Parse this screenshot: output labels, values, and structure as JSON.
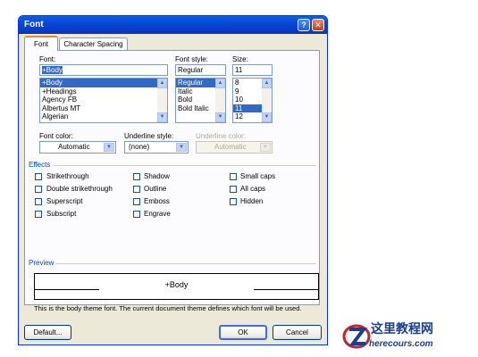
{
  "window": {
    "title": "Font",
    "help": "?",
    "close": "✕"
  },
  "tabs": [
    {
      "label": "Font"
    },
    {
      "label": "Character Spacing"
    }
  ],
  "font": {
    "label": "Font:",
    "value": "+Body",
    "items": [
      "+Body",
      "+Headings",
      "Agency FB",
      "Albertus MT",
      "Algerian"
    ],
    "selected": "+Body"
  },
  "style": {
    "label": "Font style:",
    "value": "Regular",
    "items": [
      "Regular",
      "Italic",
      "Bold",
      "Bold Italic"
    ],
    "selected": "Regular"
  },
  "size": {
    "label": "Size:",
    "value": "11",
    "items": [
      "8",
      "9",
      "10",
      "11",
      "12"
    ],
    "selected": "11"
  },
  "font_color": {
    "label": "Font color:",
    "value": "Automatic"
  },
  "underline_style": {
    "label": "Underline style:",
    "value": "(none)"
  },
  "underline_color": {
    "label": "Underline color:",
    "value": "Automatic"
  },
  "effects": {
    "label": "Effects",
    "items": [
      {
        "label": "Strikethrough",
        "checked": false
      },
      {
        "label": "Double strikethrough",
        "checked": false
      },
      {
        "label": "Superscript",
        "checked": false
      },
      {
        "label": "Subscript",
        "checked": false
      },
      {
        "label": "Shadow",
        "checked": false
      },
      {
        "label": "Outline",
        "checked": false
      },
      {
        "label": "Emboss",
        "checked": false
      },
      {
        "label": "Engrave",
        "checked": false
      },
      {
        "label": "Small caps",
        "checked": false
      },
      {
        "label": "All caps",
        "checked": false
      },
      {
        "label": "Hidden",
        "checked": false
      }
    ]
  },
  "preview": {
    "label": "Preview",
    "sample": "+Body",
    "description": "This is the body theme font. The current document theme defines which font will be used."
  },
  "buttons": {
    "default": "Default...",
    "ok": "OK",
    "cancel": "Cancel"
  },
  "watermark": {
    "line1": "这里教程网",
    "line2": "herecours.com"
  },
  "colors": {
    "titlebar": "#0a5fe8",
    "selection": "#316ac5",
    "section": "#0046d5",
    "dialog_bg": "#ece9d8"
  }
}
